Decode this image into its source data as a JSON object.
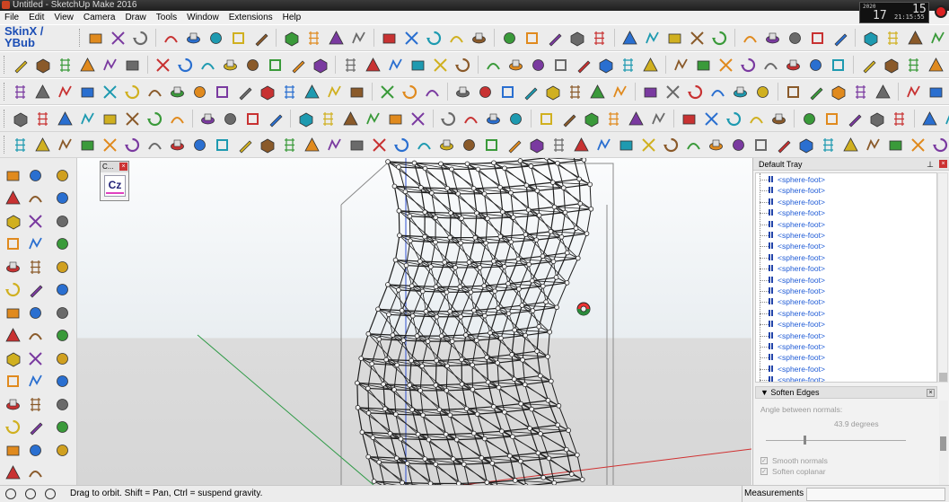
{
  "window": {
    "title": "Untitled - SketchUp Make 2016"
  },
  "clock": {
    "top_small": "2020",
    "big_left": "17",
    "big_right": "15",
    "small": "21:15:55"
  },
  "menu": [
    "File",
    "Edit",
    "View",
    "Camera",
    "Draw",
    "Tools",
    "Window",
    "Extensions",
    "Help"
  ],
  "toolbars": {
    "skinx_title": "SkinX / YBub"
  },
  "viewport": {
    "mini_panel_title": "C...",
    "mini_panel_button": "Cz"
  },
  "tray": {
    "title": "Default Tray",
    "pin_icon": "pin-icon",
    "outliner_items": [
      "<sphere-foot>",
      "<sphere-foot>",
      "<sphere-foot>",
      "<sphere-foot>",
      "<sphere-foot>",
      "<sphere-foot>",
      "<sphere-foot>",
      "<sphere-foot>",
      "<sphere-foot>",
      "<sphere-foot>",
      "<sphere-foot>",
      "<sphere-foot>",
      "<sphere-foot>",
      "<sphere-foot>",
      "<sphere-foot>",
      "<sphere-foot>",
      "<sphere-foot>",
      "<sphere-foot>",
      "<sphere-foot>"
    ],
    "soften": {
      "title": "Soften Edges",
      "angle_label": "Angle between normals:",
      "angle_value": "43.9  degrees",
      "angle_fraction": 0.28,
      "smooth_normals": "Smooth normals",
      "soften_coplanar": "Soften coplanar",
      "smooth_normals_checked": true,
      "soften_coplanar_checked": true
    }
  },
  "statusbar": {
    "hint": "Drag to orbit. Shift = Pan, Ctrl = suspend gravity.",
    "measurements_label": "Measurements",
    "measurements_value": ""
  },
  "colors": {
    "skinx_blue": "#1a4db5",
    "outliner_link": "#1f5bd6",
    "axis_red": "#d03030",
    "axis_green": "#2e9a46",
    "axis_blue": "#3050d0"
  }
}
